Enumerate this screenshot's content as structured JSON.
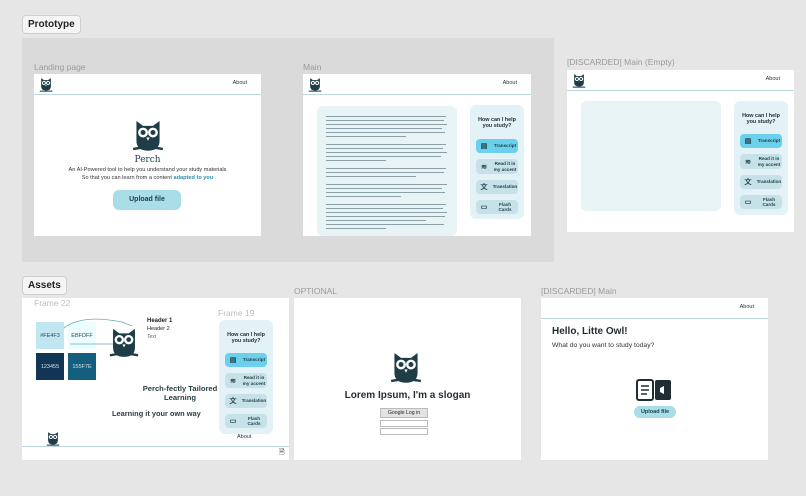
{
  "sections": {
    "prototype": "Prototype",
    "assets": "Assets"
  },
  "frames": {
    "landing": {
      "label": "Landing page",
      "about": "About",
      "brand": "Perch",
      "tagline1": "An AI-Powered tool to help you understand your study materials",
      "tagline2_prefix": "So that you can learn from a content ",
      "tagline2_highlight": "adapted to you",
      "upload": "Upload file"
    },
    "main": {
      "label": "Main",
      "about": "About",
      "help_title": "How can I help you study?",
      "buttons": [
        "Transcript",
        "Read it in my accent",
        "Translation",
        "Flash Cards"
      ]
    },
    "main_empty": {
      "label": "[DISCARDED] Main (Empty)",
      "about": "About",
      "help_title": "How can I help you study?",
      "buttons": [
        "Transcript",
        "Read it in my accent",
        "Translation",
        "Flash Cards"
      ]
    },
    "frame22": {
      "label": "Frame 22",
      "swatches": [
        "#FE4F3",
        "EBFDFF",
        "123455",
        "155F7E"
      ],
      "header1": "Header 1",
      "header2": "Header 2",
      "text": "Text",
      "slogan1": "Perch-fectly Tailored",
      "slogan2": "Learning",
      "slogan3": "Learning it your own way"
    },
    "frame19": {
      "label": "Frame 19",
      "help_title": "How can I help you study?",
      "buttons": [
        "Transcript",
        "Read it in my accent",
        "Translation",
        "Flash Cards"
      ],
      "about": "About"
    },
    "optional": {
      "label": "OPTIONAL",
      "slogan": "Lorem Ipsum, I'm a slogan",
      "google": "Google Log in"
    },
    "discarded_main": {
      "label": "[DISCARDED] Main",
      "about": "About",
      "greeting": "Hello, Litte Owl!",
      "question": "What do you want to study today?",
      "upload": "Upload file"
    }
  },
  "colors": {
    "canvas": "#e6e6e6",
    "accent": "#a9dde8",
    "active": "#6ad0ec",
    "panel": "#e8f3f6",
    "dark_navy": "#123455",
    "teal_dark": "#155f7e"
  }
}
